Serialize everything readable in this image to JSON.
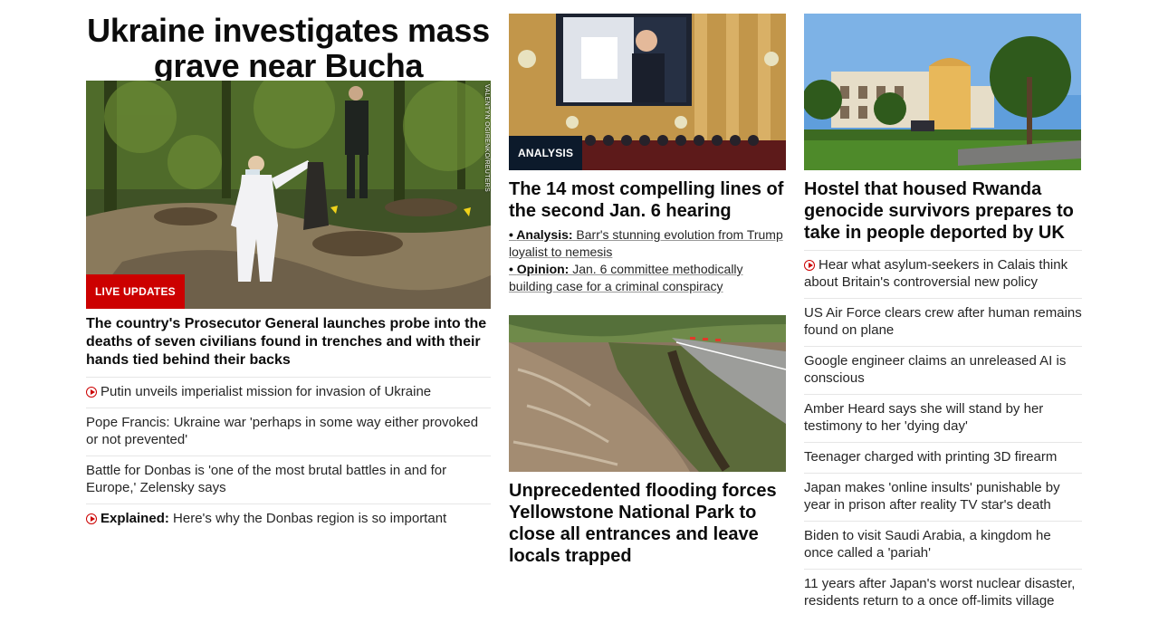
{
  "main_story": {
    "headline_line1": "Ukraine investigates mass",
    "headline_line2": "grave near Bucha",
    "image_credit": "VALENTYN OGIRENKO/REUTERS",
    "badge": "LIVE UPDATES",
    "lede": "The country's Prosecutor General launches probe into the deaths of seven civilians found in trenches and with their hands tied behind their backs",
    "related": [
      {
        "video": true,
        "prefix": "",
        "text": "Putin unveils imperialist mission for invasion of Ukraine"
      },
      {
        "video": false,
        "prefix": "",
        "text": "Pope Francis: Ukraine war 'perhaps in some way either provoked or not prevented'"
      },
      {
        "video": false,
        "prefix": "",
        "text": "Battle for Donbas is 'one of the most brutal battles in and for Europe,' Zelensky says"
      },
      {
        "video": true,
        "prefix": "Explained:",
        "text": " Here's why the Donbas region is so important"
      }
    ]
  },
  "jan6_story": {
    "badge": "ANALYSIS",
    "headline": "The 14 most compelling lines of the second Jan. 6 hearing",
    "sub_links": [
      {
        "bullet": "• ",
        "prefix": "Analysis:",
        "text": " Barr's stunning evolution from Trump loyalist to nemesis"
      },
      {
        "bullet": "• ",
        "prefix": "Opinion:",
        "text": " Jan. 6 committee methodically building case for a criminal conspiracy"
      }
    ]
  },
  "flood_story": {
    "headline": "Unprecedented flooding forces Yellowstone National Park to close all entrances and leave locals trapped"
  },
  "rwanda_story": {
    "headline": "Hostel that housed Rwanda genocide survivors prepares to take in people deported by UK",
    "related": [
      {
        "video": true,
        "text": "Hear what asylum-seekers in Calais think about Britain's controversial new policy"
      },
      {
        "video": false,
        "text": "US Air Force clears crew after human remains found on plane"
      },
      {
        "video": false,
        "text": "Google engineer claims an unreleased AI is conscious"
      },
      {
        "video": false,
        "text": "Amber Heard says she will stand by her testimony to her 'dying day'"
      },
      {
        "video": false,
        "text": "Teenager charged with printing 3D firearm"
      },
      {
        "video": false,
        "text": "Japan makes 'online insults' punishable by year in prison after reality TV star's death"
      },
      {
        "video": false,
        "text": "Biden to visit Saudi Arabia, a kingdom he once called a 'pariah'"
      },
      {
        "video": false,
        "text": "11 years after Japan's worst nuclear disaster, residents return to a once off-limits village"
      }
    ]
  },
  "colors": {
    "live_badge": "#cc0000",
    "analysis_badge": "#0c1a2b",
    "video_icon": "#cc0000"
  }
}
